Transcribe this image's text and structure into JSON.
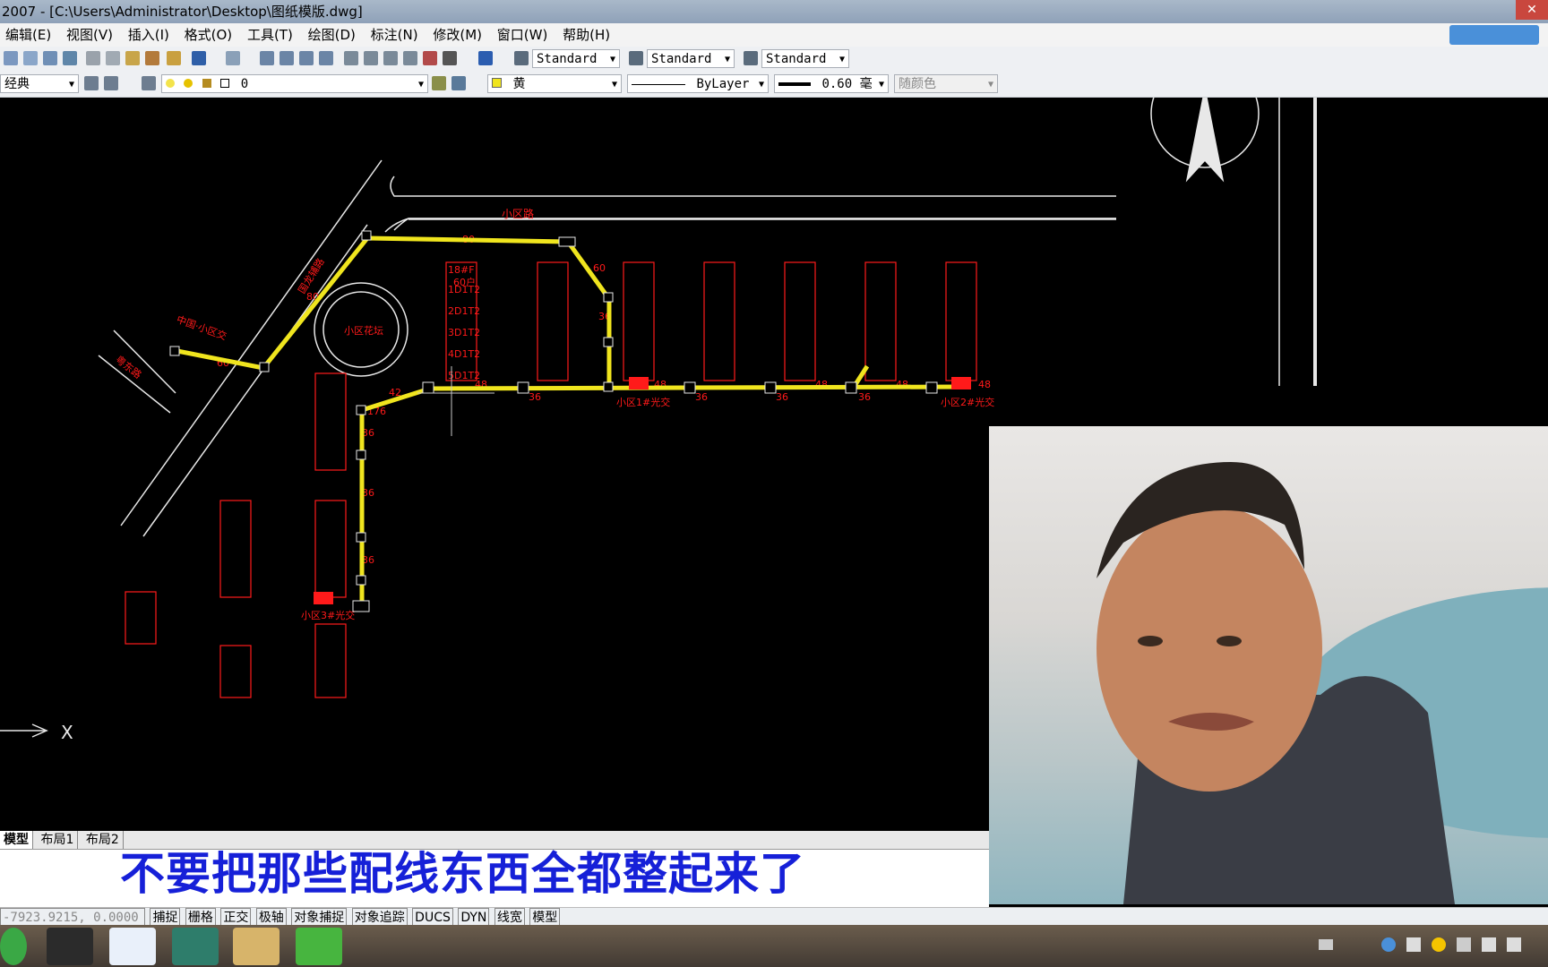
{
  "window": {
    "title": "2007 - [C:\\Users\\Administrator\\Desktop\\图纸模版.dwg]",
    "close_label": "✕"
  },
  "menu": [
    "编辑(E)",
    "视图(V)",
    "插入(I)",
    "格式(O)",
    "工具(T)",
    "绘图(D)",
    "标注(N)",
    "修改(M)",
    "窗口(W)",
    "帮助(H)"
  ],
  "toolbar": {
    "text_style": "Standard",
    "dim_style": "Standard",
    "table_style": "Standard",
    "workspace": "经典",
    "layer": "0",
    "color": "黄",
    "linetype": "ByLayer",
    "lineweight": "0.60 毫",
    "plot_style": "随颜色"
  },
  "drawing": {
    "road_label": "小区路",
    "road_label_2": "国龙辅路",
    "road_label_3": "粤东路",
    "garden_label": "小区花坛",
    "entry_label": "中国·小区交",
    "junction_labels": [
      "小区1#光交",
      "小区2#光交",
      "小区3#光交"
    ],
    "segment_labels": [
      "80",
      "60",
      "80",
      "60",
      "48",
      "48",
      "48",
      "48",
      "48",
      "42",
      "36",
      "36",
      "36",
      "36",
      "36",
      "36",
      "36",
      "36",
      "176"
    ],
    "building_labels": [
      "18#F",
      "60户",
      "1D1T2",
      "2D1T2",
      "3D1T2",
      "4D1T2",
      "5D1T2"
    ],
    "axis_label": "X"
  },
  "tabs": [
    "模型",
    "布局1",
    "布局2"
  ],
  "subtitle": "不要把那些配线东西全都整起来了",
  "status": {
    "coords": "-7923.9215, 0.0000",
    "buttons": [
      "捕捉",
      "栅格",
      "正交",
      "极轴",
      "对象捕捉",
      "对象追踪",
      "DUCS",
      "DYN",
      "线宽",
      "模型"
    ]
  },
  "colors": {
    "line": "#f0e51e",
    "red": "#ff1a1a",
    "road": "#e8e8e8",
    "subtitle": "#1620d8"
  }
}
